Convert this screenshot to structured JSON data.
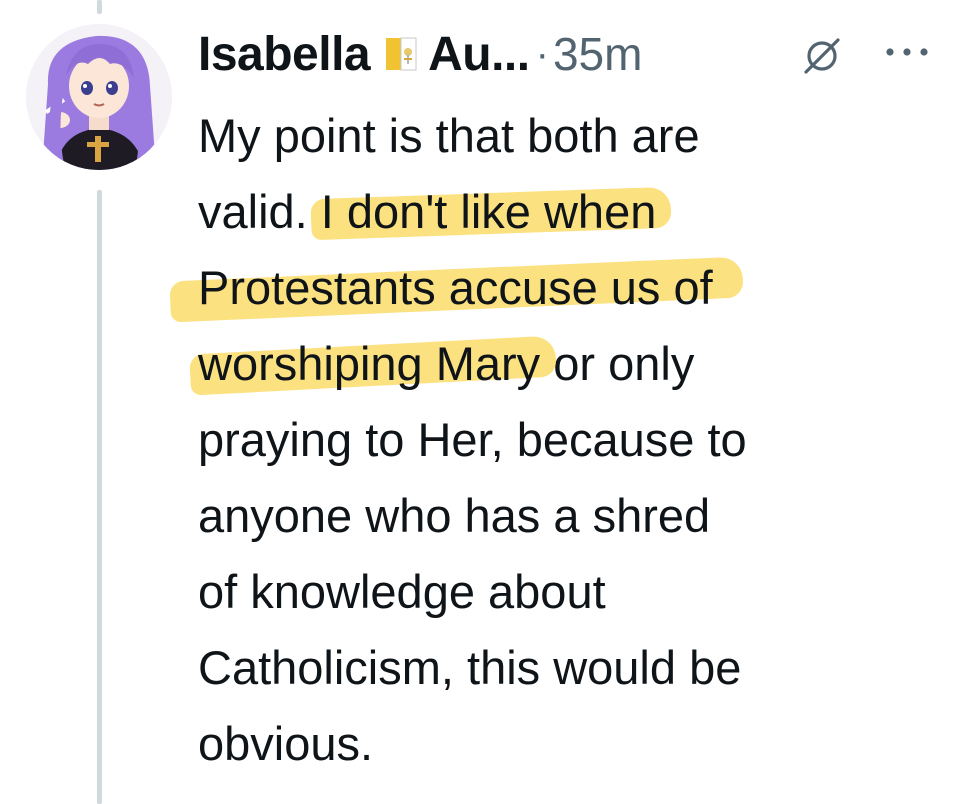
{
  "tweet": {
    "author": {
      "display_name": "Isabella",
      "name_suffix": "Au...",
      "flag_icon": "vatican-flag-icon"
    },
    "separator": "·",
    "timestamp": "35m",
    "grok_icon": "grok-icon",
    "more_icon": "more-icon",
    "text_lines": [
      {
        "plain_before": "My point is that both are",
        "highlight": "",
        "plain_after": ""
      },
      {
        "plain_before": "valid. ",
        "highlight": "I don't like when",
        "plain_after": ""
      },
      {
        "plain_before": "",
        "highlight": "Protestants accuse us of",
        "plain_after": ""
      },
      {
        "plain_before": "",
        "highlight": "worshiping Mary",
        "plain_after": " or only"
      },
      {
        "plain_before": "praying to Her, because to",
        "highlight": "",
        "plain_after": ""
      },
      {
        "plain_before": "anyone who has a shred",
        "highlight": "",
        "plain_after": ""
      },
      {
        "plain_before": "of knowledge about",
        "highlight": "",
        "plain_after": ""
      },
      {
        "plain_before": "Catholicism, this would be",
        "highlight": "",
        "plain_after": ""
      },
      {
        "plain_before": "obvious.",
        "highlight": "",
        "plain_after": ""
      }
    ]
  },
  "colors": {
    "text": "#0f1419",
    "muted": "#536471",
    "thread_line": "#cfd9de",
    "highlight": "#fbdc6a",
    "avatar_hair": "#9b7be0"
  }
}
